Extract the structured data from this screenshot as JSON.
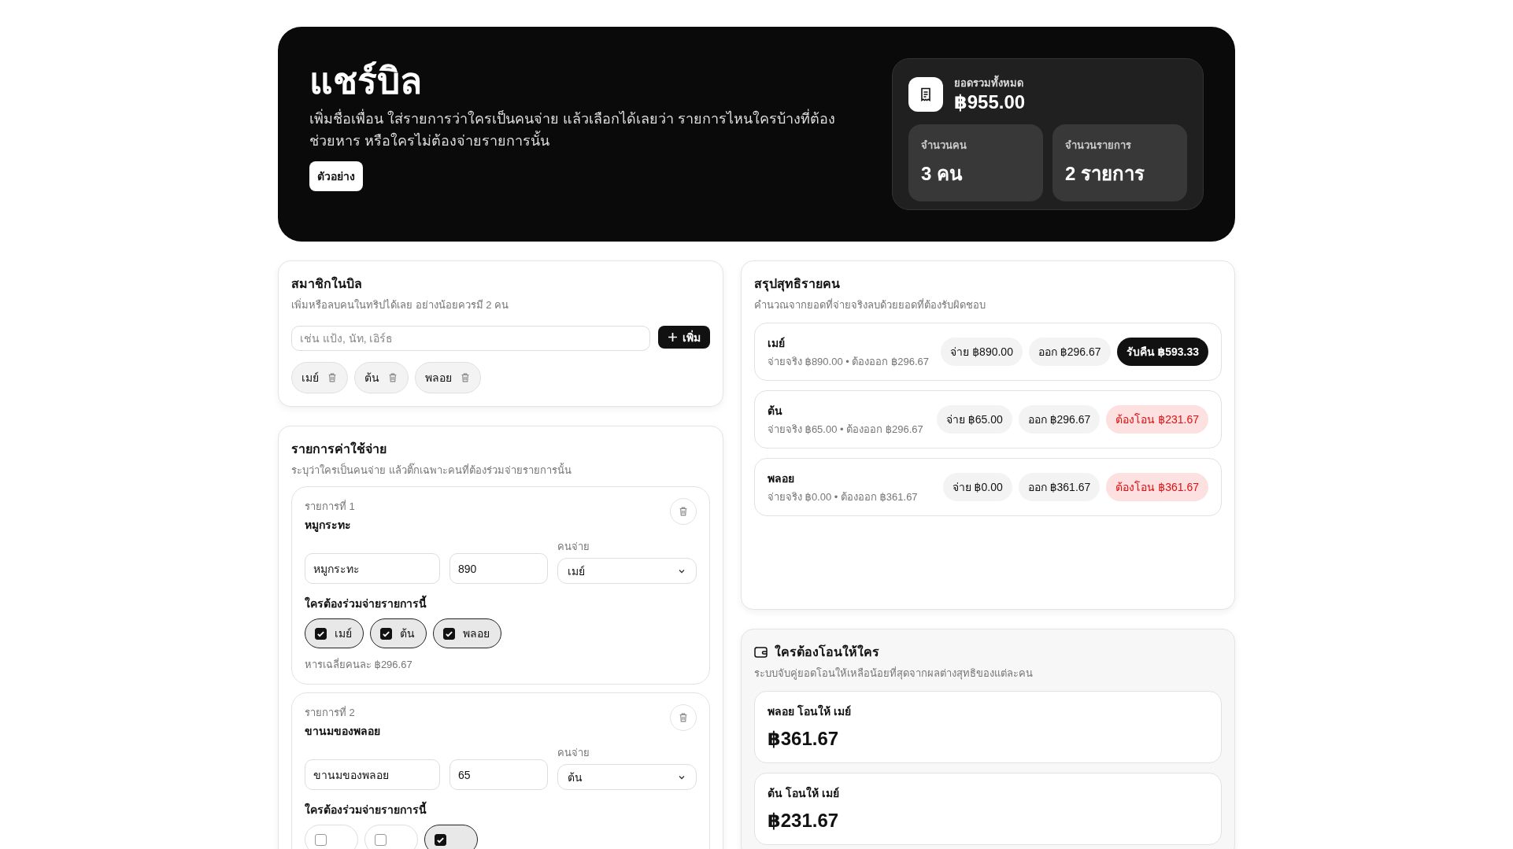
{
  "header": {
    "title": "แชร์บิล",
    "description": "เพิ่มชื่อเพื่อน ใส่รายการว่าใครเป็นคนจ่าย แล้วเลือกได้เลยว่า รายการไหนใครบ้างที่ต้องช่วยหาร หรือใครไม่ต้องจ่ายรายการนั้น",
    "example_button": "ตัวอย่าง",
    "total": {
      "label": "ยอดรวมทั้งหมด",
      "value": "฿955.00"
    },
    "stats": [
      {
        "label": "จำนวนคน",
        "value": "3 คน"
      },
      {
        "label": "จำนวนรายการ",
        "value": "2 รายการ"
      }
    ]
  },
  "members": {
    "title": "สมาชิกในบิล",
    "subtitle": "เพิ่มหรือลบคนในทริปได้เลย อย่างน้อยควรมี 2 คน",
    "placeholder": "เช่น แป้ง, นัท, เอิร์ธ",
    "add_button": "เพิ่ม",
    "people": [
      "เมย์",
      "ต้น",
      "พลอย"
    ]
  },
  "expenses": {
    "title": "รายการค่าใช้จ่าย",
    "subtitle": "ระบุว่าใครเป็นคนจ่าย แล้วติ๊กเฉพาะคนที่ต้องร่วมจ่ายรายการนั้น",
    "items": [
      {
        "number_label": "รายการที่ 1",
        "name": "หมูกระทะ",
        "name_value": "หมูกระทะ",
        "amount": "890",
        "payer_label": "คนจ่าย",
        "payer": "เมย์",
        "share_label": "ใครต้องร่วมจ่ายรายการนี้",
        "shares": [
          {
            "name": "เมย์",
            "checked": true
          },
          {
            "name": "ต้น",
            "checked": true
          },
          {
            "name": "พลอย",
            "checked": true
          }
        ],
        "average": "หารเฉลี่ยคนละ ฿296.67"
      },
      {
        "number_label": "รายการที่ 2",
        "name": "ขานมของพลอย",
        "name_value": "ขานมของพลอย",
        "amount": "65",
        "payer_label": "คนจ่าย",
        "payer": "ต้น",
        "share_label": "ใครต้องร่วมจ่ายรายการนี้",
        "shares": [
          {
            "checked": false
          },
          {
            "checked": false
          },
          {
            "checked": true
          }
        ]
      }
    ]
  },
  "summary": {
    "title": "สรุปสุทธิรายคน",
    "subtitle": "คำนวณจากยอดที่จ่ายจริงลบด้วยยอดที่ต้องรับผิดชอบ",
    "rows": [
      {
        "name": "เมย์",
        "detail": "จ่ายจริง ฿890.00 • ต้องออก ฿296.67",
        "paid": "จ่าย ฿890.00",
        "owed": "ออก ฿296.67",
        "net": "รับคืน ฿593.33",
        "kind": "receive"
      },
      {
        "name": "ต้น",
        "detail": "จ่ายจริง ฿65.00 • ต้องออก ฿296.67",
        "paid": "จ่าย ฿65.00",
        "owed": "ออก ฿296.67",
        "net": "ต้องโอน ฿231.67",
        "kind": "pay"
      },
      {
        "name": "พลอย",
        "detail": "จ่ายจริง ฿0.00 • ต้องออก ฿361.67",
        "paid": "จ่าย ฿0.00",
        "owed": "ออก ฿361.67",
        "net": "ต้องโอน ฿361.67",
        "kind": "pay"
      }
    ]
  },
  "transfers": {
    "title": "ใครต้องโอนให้ใคร",
    "subtitle": "ระบบจับคู่ยอดโอนให้เหลือน้อยที่สุดจากผลต่างสุทธิของแต่ละคน",
    "items": [
      {
        "label": "พลอย โอนให้ เมย์",
        "amount": "฿361.67"
      },
      {
        "label": "ต้น โอนให้ เมย์",
        "amount": "฿231.67"
      }
    ]
  }
}
